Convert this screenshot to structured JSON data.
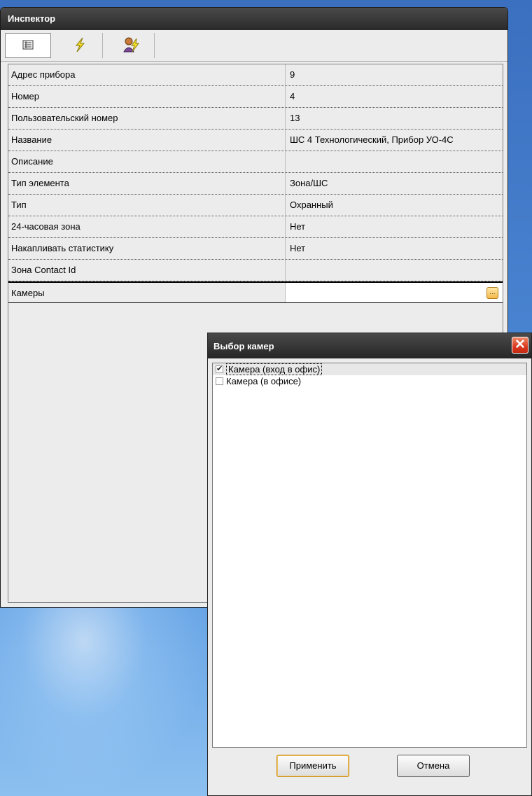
{
  "inspector": {
    "title": "Инспектор",
    "tabs": [
      {
        "icon": "properties-list-icon"
      },
      {
        "icon": "lightning-icon"
      },
      {
        "icon": "user-lightning-icon"
      }
    ],
    "properties": [
      {
        "name": "Адрес прибора",
        "value": "9"
      },
      {
        "name": "Номер",
        "value": "4"
      },
      {
        "name": "Пользовательский номер",
        "value": "13"
      },
      {
        "name": "Название",
        "value": "ШС 4 Технологический, Прибор УО-4С"
      },
      {
        "name": "Описание",
        "value": ""
      },
      {
        "name": "Тип элемента",
        "value": "Зона/ШС"
      },
      {
        "name": "Тип",
        "value": "Охранный"
      },
      {
        "name": "24-часовая зона",
        "value": "Нет"
      },
      {
        "name": "Накапливать статистику",
        "value": "Нет"
      },
      {
        "name": "Зона Contact Id",
        "value": ""
      },
      {
        "name": "Камеры",
        "value": ""
      }
    ]
  },
  "dialog": {
    "title": "Выбор камер",
    "cameras": [
      {
        "label": "Камера (вход в офис)",
        "checked": true
      },
      {
        "label": "Камера (в офисе)",
        "checked": false
      }
    ],
    "apply_label": "Применить",
    "cancel_label": "Отмена"
  }
}
